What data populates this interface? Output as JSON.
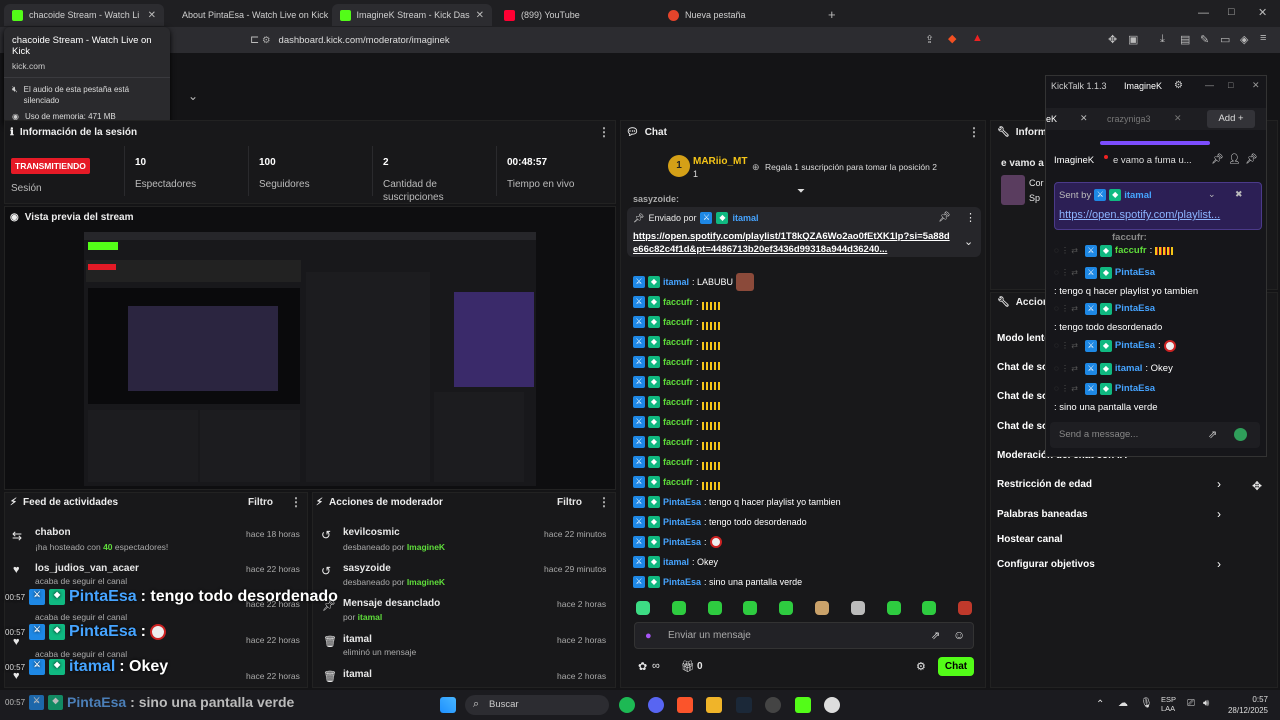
{
  "browser": {
    "tabs": [
      {
        "label": "chacoide Stream - Watch Live",
        "color": "#53fc18"
      },
      {
        "label": "About PintaEsa - Watch Live on Kick",
        "color": "#53fc18"
      },
      {
        "label": "ImagineK Stream - Kick Dash",
        "color": "#53fc18"
      },
      {
        "label": "(899) YouTube",
        "color": "#ff0033"
      },
      {
        "label": "Nueva pestaña",
        "color": "#e4442b"
      }
    ],
    "url": "dashboard.kick.com/moderator/imaginek",
    "tooltip": {
      "title": "chacoide Stream - Watch Live on Kick",
      "domain": "kick.com",
      "muted": "El audio de esta pestaña está silenciado",
      "memory": "Uso de memoria: 471 MB"
    }
  },
  "session": {
    "title": "Información de la sesión",
    "status": "TRANSMITIENDO",
    "status_label": "Sesión",
    "stats": [
      {
        "value": "10",
        "label": "Espectadores"
      },
      {
        "value": "100",
        "label": "Seguidores"
      },
      {
        "value": "2",
        "label": "Cantidad de suscripciones"
      },
      {
        "value": "00:48:57",
        "label": "Tiempo en vivo"
      }
    ]
  },
  "preview": {
    "title": "Vista previa del stream"
  },
  "activity": {
    "title": "Feed de actividades",
    "filter": "Filtro",
    "items": [
      {
        "name": "chabon",
        "desc_a": "¡ha hosteado con ",
        "desc_num": "40",
        "desc_b": " espectadores!",
        "time": "hace 18 horas"
      },
      {
        "name": "los_judios_van_acaer",
        "desc": "acaba de seguir el canal",
        "time": "hace 22 horas"
      },
      {
        "name": "",
        "desc": "acaba de seguir el canal",
        "time": "hace 22 horas"
      },
      {
        "name": "",
        "desc": "acaba de seguir el canal",
        "time": "hace 22 horas"
      },
      {
        "name": "",
        "desc": "",
        "time": "hace 22 horas"
      }
    ]
  },
  "modactions": {
    "title": "Acciones de moderador",
    "filter": "Filtro",
    "items": [
      {
        "name": "kevilcosmic",
        "desc": "desbaneado por ",
        "by": "ImagineK",
        "time": "hace 22 minutos"
      },
      {
        "name": "sasyzoide",
        "desc": "desbaneado por ",
        "by": "ImagineK",
        "time": "hace 29 minutos"
      },
      {
        "name": "Mensaje desanclado",
        "desc": "por ",
        "by": "itamal",
        "time": "hace 2 horas"
      },
      {
        "name": "itamal",
        "desc": "eliminó un mensaje",
        "by": "",
        "time": "hace 2 horas"
      },
      {
        "name": "itamal",
        "desc": "",
        "by": "",
        "time": "hace 2 horas"
      }
    ]
  },
  "chat": {
    "title": "Chat",
    "top_user": "MARiio_MT",
    "top_count": "1",
    "gift_text": "Regala 1 suscripción para tomar la posición 2",
    "pinned_by_label": "Enviado por",
    "pinned_user": "itamal",
    "pinned_link": "https://open.spotify.com/playlist/1T8kQZA6Wo2ao0fEtXK1lp?si=5a88de66c82c4f1d&pt=4486713b20ef3436d99318a944d36240...",
    "partial_user": "sasyzoide:",
    "messages": [
      {
        "user": "itamal",
        "text": ": LABUBU"
      },
      {
        "user": "faccufr",
        "text": ":"
      },
      {
        "user": "faccufr",
        "text": ":"
      },
      {
        "user": "faccufr",
        "text": ":"
      },
      {
        "user": "faccufr",
        "text": ":"
      },
      {
        "user": "faccufr",
        "text": ":"
      },
      {
        "user": "faccufr",
        "text": ":"
      },
      {
        "user": "faccufr",
        "text": ":"
      },
      {
        "user": "faccufr",
        "text": ":"
      },
      {
        "user": "faccufr",
        "text": ":"
      },
      {
        "user": "faccufr",
        "text": ":"
      },
      {
        "user": "PintaEsa",
        "text": ": tengo q hacer playlist yo tambien"
      },
      {
        "user": "PintaEsa",
        "text": ": tengo todo desordenado"
      },
      {
        "user": "PintaEsa",
        "text": ":"
      },
      {
        "user": "itamal",
        "text": ": Okey"
      },
      {
        "user": "PintaEsa",
        "text": ": sino una pantalla verde"
      }
    ],
    "input_placeholder": "Enviar un mensaje",
    "points": "0",
    "send_label": "Chat"
  },
  "right": {
    "info_title": "Informa",
    "chat_title_partial": "e vamo a",
    "chat_sub1": "Cor",
    "chat_sub2": "Sp",
    "actions_title": "Accione",
    "actions": [
      "Modo lento",
      "Chat de so",
      "Chat de so",
      "Chat de so",
      "Moderación del chat con IA",
      "Restricción de edad",
      "Palabras baneadas",
      "Hostear canal",
      "Configurar objetivos"
    ]
  },
  "kicktalk": {
    "title": "KickTalk 1.1.3",
    "user": "ImagineK",
    "tab1": "eK",
    "tab2": "crazyniga3",
    "add": "Add",
    "channel_name": "ImagineK",
    "channel_title": "e vamo a fuma u...",
    "sent_by": "Sent by",
    "sent_user": "itamal",
    "pinned_link": "https://open.spotify.com/playlist...",
    "partial": "faccufr:",
    "messages": [
      {
        "user": "faccufr",
        "text": ":"
      },
      {
        "user": "PintaEsa",
        "text": ": tengo q hacer playlist yo tambien"
      },
      {
        "user": "PintaEsa",
        "text": ": tengo todo desordenado"
      },
      {
        "user": "PintaEsa",
        "text": ":"
      },
      {
        "user": "itamal",
        "text": ": Okey"
      },
      {
        "user": "PintaEsa",
        "text": ": sino una pantalla verde"
      }
    ],
    "input_placeholder": "Send a message..."
  },
  "overlay": [
    {
      "time": "00:57",
      "user": "PintaEsa",
      "text": ": tengo todo desordenado"
    },
    {
      "time": "00:57",
      "user": "PintaEsa",
      "text": ":"
    },
    {
      "time": "00:57",
      "user": "itamal",
      "text": ": Okey"
    }
  ],
  "taskbar": {
    "overlay_time": "00:57",
    "overlay_user": "PintaEsa",
    "overlay_text": ": sino una pantalla verde",
    "search": "Buscar",
    "lang1": "ESP",
    "lang2": "LAA",
    "time": "0:57",
    "date": "28/12/2025"
  }
}
